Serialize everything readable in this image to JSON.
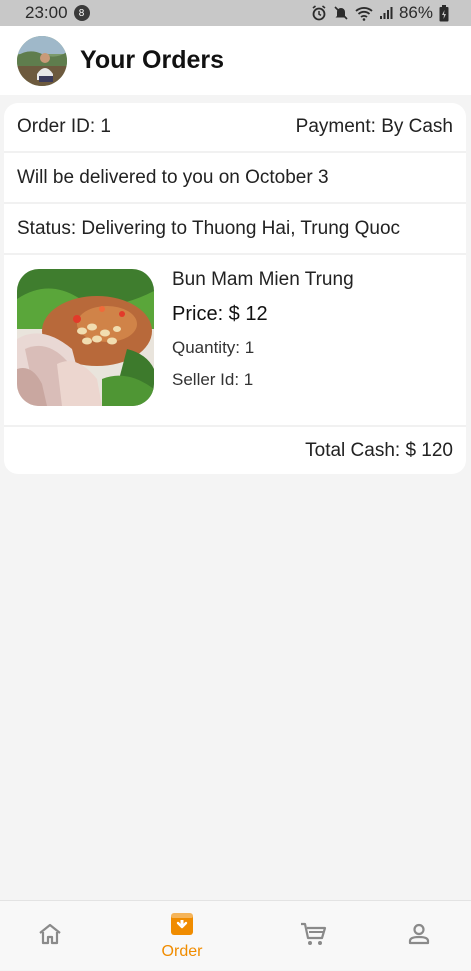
{
  "status_bar": {
    "time": "23:00",
    "notification_count": "8",
    "battery": "86%"
  },
  "header": {
    "title": "Your Orders"
  },
  "order": {
    "order_id": "Order ID: 1",
    "payment": "Payment: By Cash",
    "delivery": "Will be delivered to you on October 3",
    "status": "Status: Delivering to Thuong Hai, Trung Quoc",
    "item": {
      "name": "Bun Mam Mien Trung",
      "price": "Price: $ 12",
      "quantity": "Quantity: 1",
      "seller": "Seller Id: 1"
    },
    "total": "Total Cash: $ 120"
  },
  "bottom_nav": {
    "items": [
      {
        "icon": "home-icon",
        "label": ""
      },
      {
        "icon": "order-box-icon",
        "label": "Order",
        "active": true
      },
      {
        "icon": "cart-icon",
        "label": ""
      },
      {
        "icon": "person-icon",
        "label": ""
      }
    ]
  },
  "colors": {
    "accent": "#f08c00",
    "inactive_icon": "#8a8a8a",
    "background": "#f4f4f4"
  }
}
